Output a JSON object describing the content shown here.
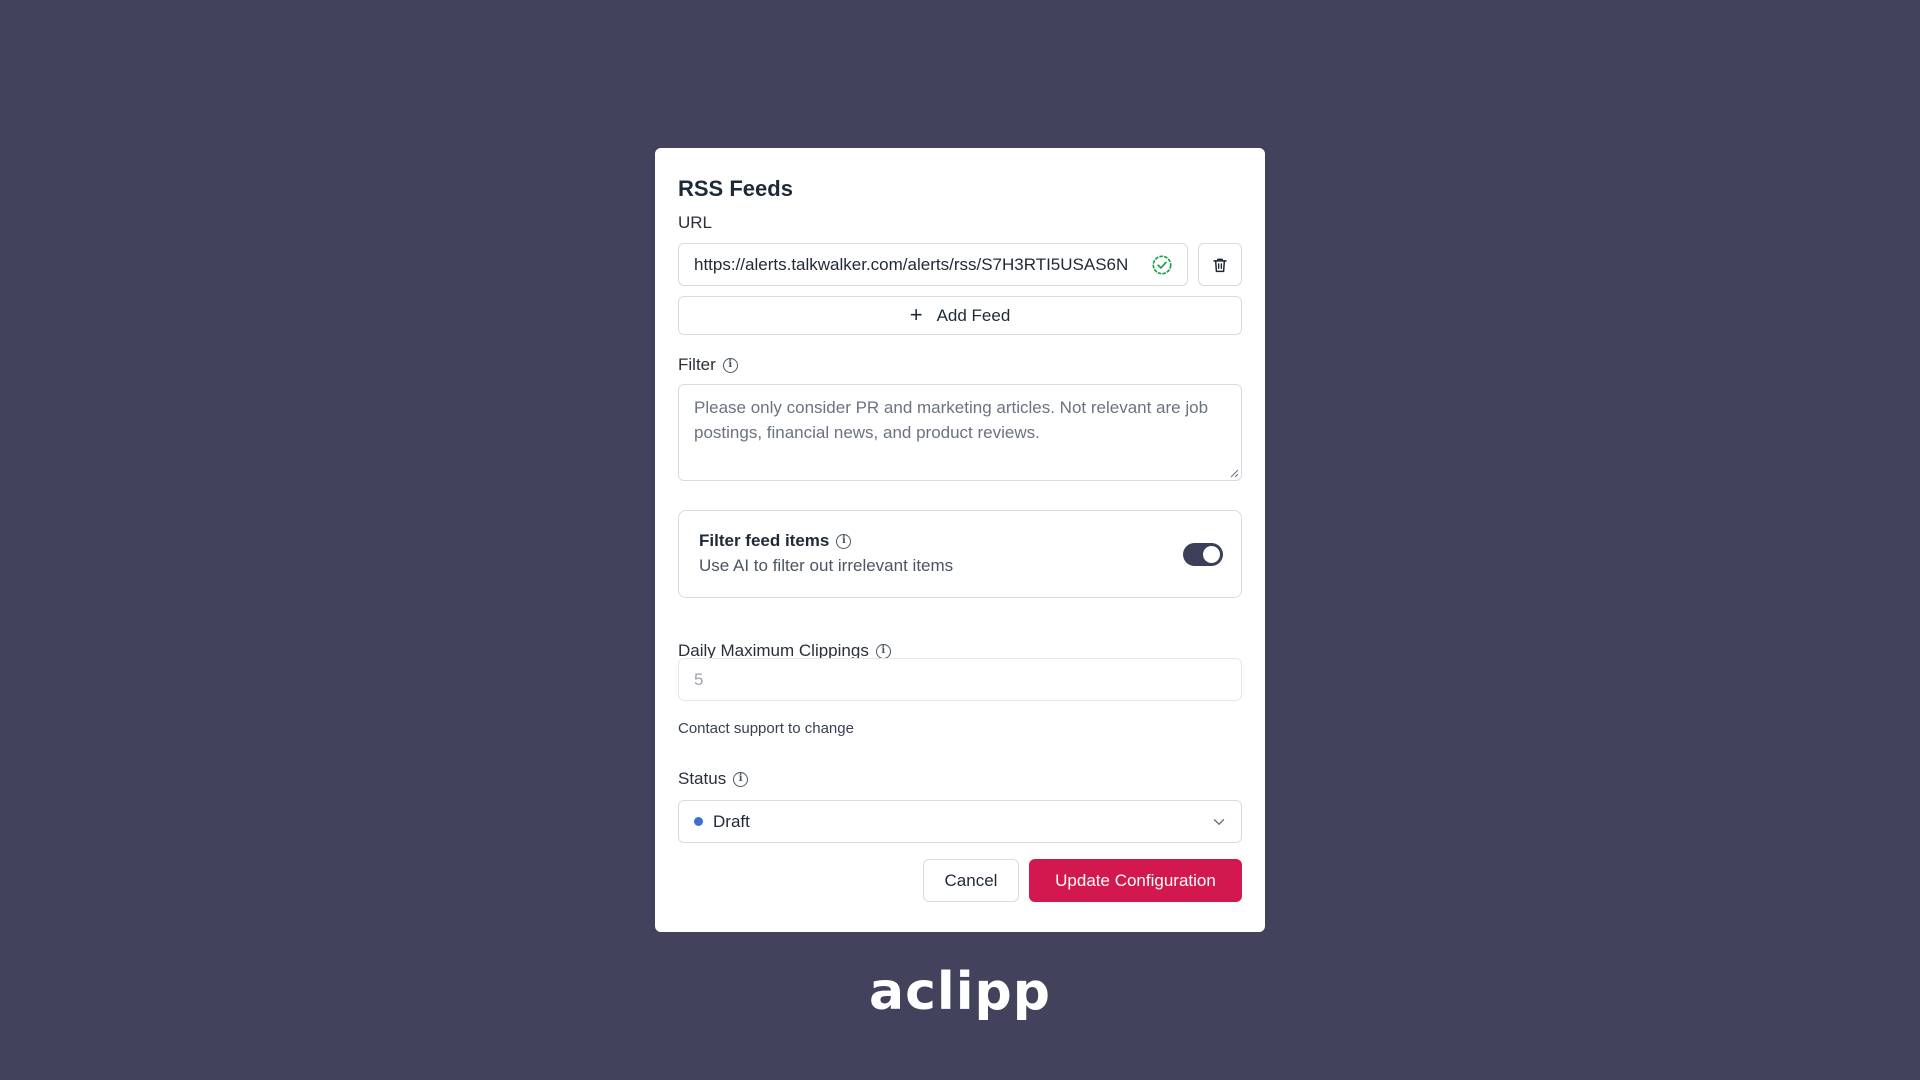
{
  "modal": {
    "title": "RSS Feeds",
    "url_label": "URL",
    "url_value": "https://alerts.talkwalker.com/alerts/rss/S7H3RTI5USAS6N",
    "add_feed_label": "Add Feed",
    "filter_label": "Filter",
    "filter_placeholder": "Please only consider PR and marketing articles. Not relevant are job postings, financial news, and product reviews.",
    "toggle": {
      "title": "Filter feed items",
      "subtitle": "Use AI to filter out irrelevant items",
      "enabled": true
    },
    "max_clippings": {
      "label": "Daily Maximum Clippings",
      "value": "5",
      "help": "Contact support to change"
    },
    "status": {
      "label": "Status",
      "selected": "Draft",
      "dot_color": "#3b6fd8"
    },
    "buttons": {
      "cancel": "Cancel",
      "update": "Update Configuration"
    }
  },
  "logo": "aclipp",
  "colors": {
    "background": "#43425d",
    "accent": "#d3184f",
    "valid_check": "#16a34a",
    "toggle_on": "#3b3f58"
  },
  "icons": {
    "url_valid": "check-circle-icon",
    "delete": "trash-icon",
    "add": "plus-icon",
    "info": "info-icon",
    "dropdown": "chevron-down-icon"
  }
}
